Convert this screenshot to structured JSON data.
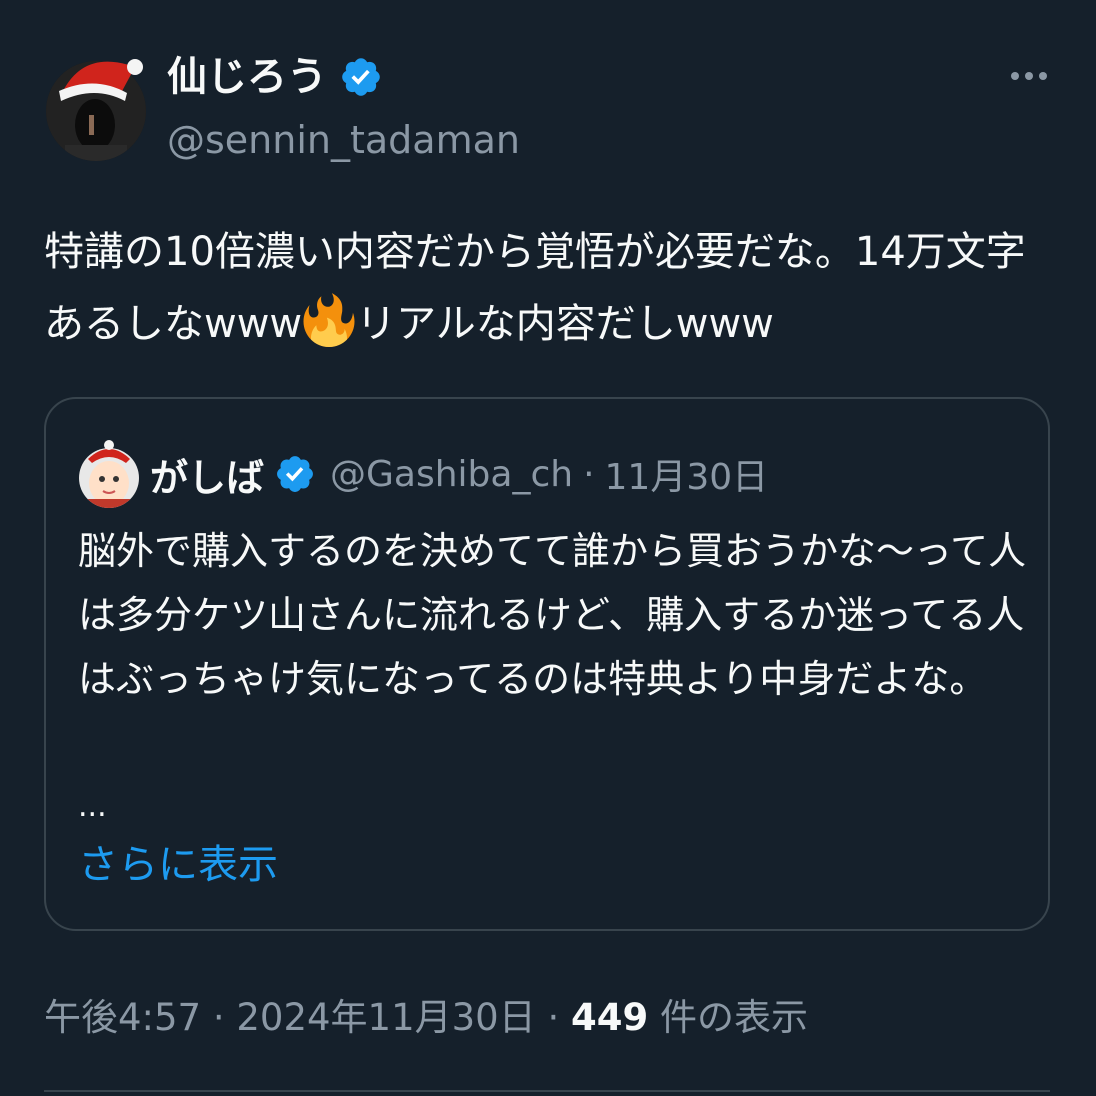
{
  "author": {
    "display_name": "仙じろう",
    "handle": "@sennin_tadaman",
    "avatar_icon": "santa-hat-avatar-icon"
  },
  "more_icon": "more-horizontal-icon",
  "tweet": {
    "text_part1": "特講の10倍濃い内容だから覚悟が必要だな。14万文字あるしなwww",
    "emoji": "fire-emoji",
    "text_part2": "リアルな内容だしwww"
  },
  "quote": {
    "display_name": "がしば",
    "handle": "@Gashiba_ch",
    "separator": "·",
    "date": "11月30日",
    "text": "脳外で購入するのを決めてて誰から買おうかな〜って人は多分ケツ山さんに流れるけど、購入するか迷ってる人はぶっちゃけ気になってるのは特典より中身だよな。",
    "ellipsis": "...",
    "show_more": "さらに表示"
  },
  "meta": {
    "time": "午後4:57",
    "sep1": " · ",
    "date": "2024年11月30日",
    "sep2": " · ",
    "views_count": "449",
    "views_label": " 件の表示"
  },
  "colors": {
    "background": "#15202b",
    "text": "#f7f9f9",
    "secondary": "#8b98a5",
    "accent": "#1d9bf0",
    "border": "#38444d"
  }
}
